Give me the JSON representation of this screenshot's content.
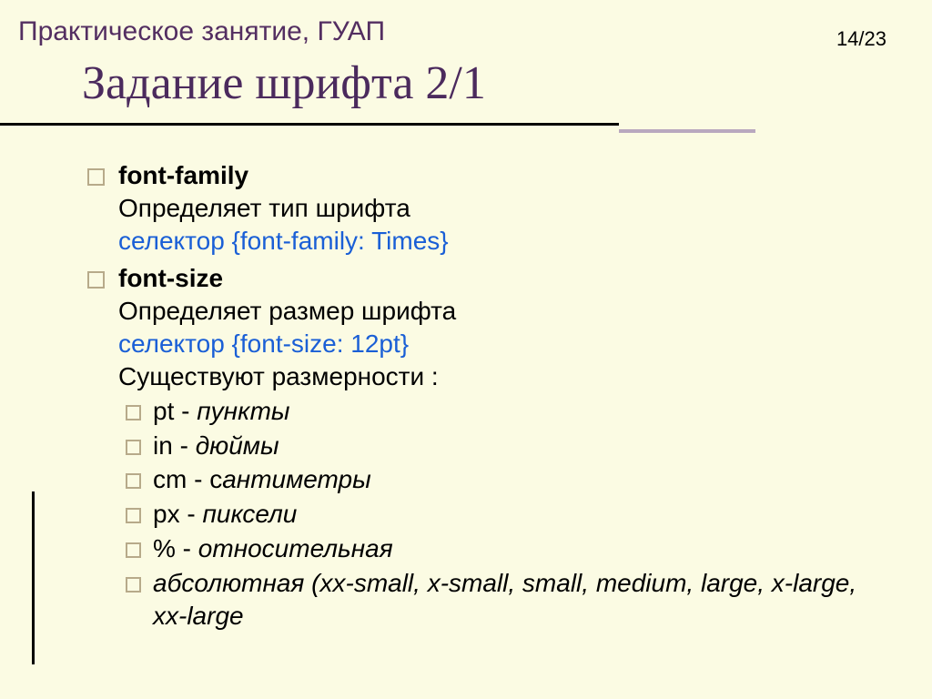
{
  "header": {
    "label": "Практическое занятие, ГУАП",
    "page": "14/23"
  },
  "title": "Задание шрифта 2/1",
  "items": [
    {
      "prop": "font-family",
      "desc": "Определяет тип шрифта",
      "example": "селектор {font-family: Times}"
    },
    {
      "prop": "font-size",
      "desc": "Определяет размер шрифта",
      "example": "селектор {font-size: 12pt}",
      "note": "Существуют размерности :",
      "units": [
        {
          "code": "pt",
          "sep": " - ",
          "label": "пункты"
        },
        {
          "code": "in",
          "sep": " - ",
          "label": "дюймы"
        },
        {
          "code": "cm",
          "sep": " - с",
          "label": "антиметры"
        },
        {
          "code": "px",
          "sep": " - ",
          "label": "пиксели"
        },
        {
          "code": "%",
          "sep": " - ",
          "label": "относительная"
        }
      ],
      "absolute": "абсолютная (xx-small, x-small, small, medium, large, x-large, xx-large"
    }
  ]
}
